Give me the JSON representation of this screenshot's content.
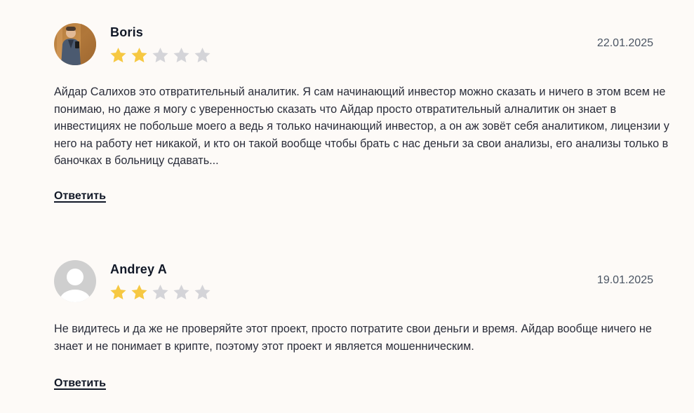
{
  "colors": {
    "background": "#fdfaf7",
    "star_filled": "#f6c842",
    "star_empty": "#d4d4d8",
    "text": "#2a2d3a"
  },
  "reviews": [
    {
      "author": "Boris",
      "avatar": "photo",
      "rating": 2,
      "max_rating": 5,
      "date": "22.01.2025",
      "text": "Айдар Салихов это отвратительный аналитик. Я сам начинающий инвестор можно сказать и ничего в этом всем не понимаю, но даже я могу с уверенностью сказать что Айдар просто отвратительный алналитик он знает в инвестициях не побольше моего а ведь я только начинающий инвестор, а он аж зовёт себя аналитиком, лицензии у него на работу нет никакой, и кто он такой вообще чтобы брать с нас деньги за свои анализы, его анализы только в баночках в больницу сдавать...",
      "reply_label": "Ответить"
    },
    {
      "author": "Andrey A",
      "avatar": "default-user-icon",
      "rating": 2,
      "max_rating": 5,
      "date": "19.01.2025",
      "text": "Не видитесь и да же не проверяйте этот проект, просто потратите свои деньги и время. Айдар вообще ничего не знает и не понимает в крипте, поэтому этот проект и является мошенническим.",
      "reply_label": "Ответить"
    }
  ]
}
